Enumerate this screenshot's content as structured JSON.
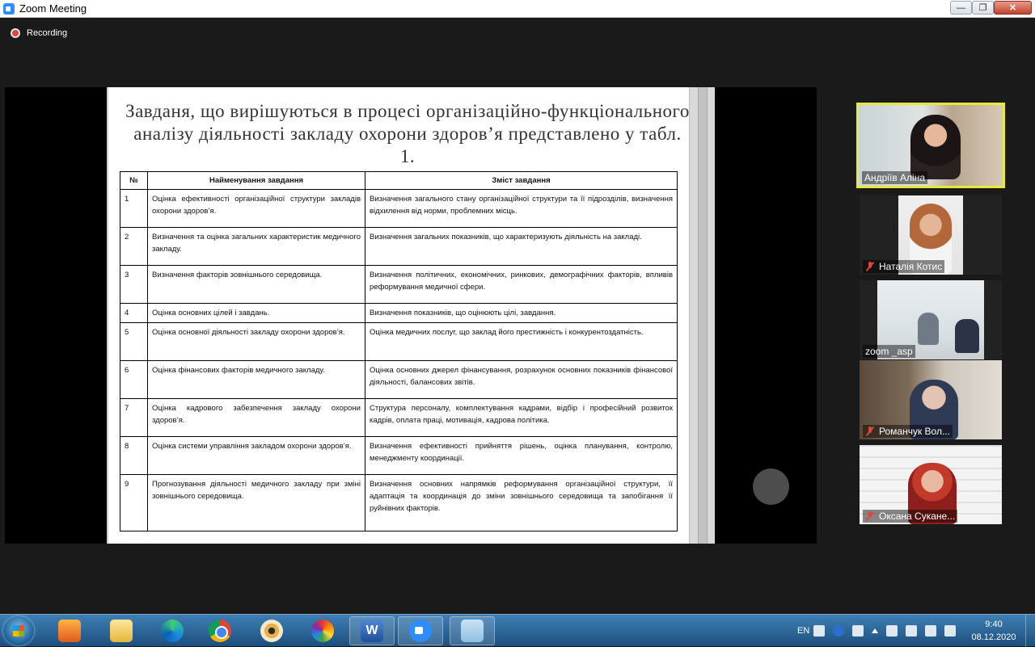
{
  "window": {
    "title": "Zoom Meeting",
    "minimize": "—",
    "maximize": "❐",
    "close": "✕"
  },
  "recording": {
    "label": "Recording"
  },
  "slide": {
    "title": "Завданя, що вирішуються в процесі організаційно-функціонального аналізу діяльності закладу охорони здоров’я представлено у табл. 1.",
    "headers": {
      "num": "№",
      "name": "Найменування завдання",
      "desc": "Зміст завдання"
    },
    "rows": [
      {
        "num": "1",
        "name": "Оцінка ефективності організаційної структури закладів охорони здоров’я.",
        "desc": "Визначення загального стану організаційної структури та її підрозділів, визначення відхилення від норми, проблемних місць."
      },
      {
        "num": "2",
        "name": "Визначення та оцінка загальних характеристик медичного закладу.",
        "desc": "Визначення загальних показників, що характеризують діяльність на закладі."
      },
      {
        "num": "3",
        "name": "Визначення факторів зовнішнього середовища.",
        "desc": "Визначення політичних, економічних, ринкових, демографічних факторів, впливів реформування медичної сфери."
      },
      {
        "num": "4",
        "name": "Оцінка основних цілей і завдань.",
        "desc": "Визначення показників, що оцінюють цілі, завдання."
      },
      {
        "num": "5",
        "name": "Оцінка основної діяльності закладу охорони здоров’я.",
        "desc": "Оцінка медичних послуг, що заклад його престижність і конкурентоздатність."
      },
      {
        "num": "6",
        "name": "Оцінка фінансових факторів медичного закладу.",
        "desc": "Оцінка основних джерел фінансування, розрахунок основних показників фінансової діяльності, балансових звітів."
      },
      {
        "num": "7",
        "name": "Оцінка кадрового забезпечення закладу охорони здоров’я.",
        "desc": "Структура персоналу, комплектування кадрами, відбір і професійний розвиток кадрів, оплата праці, мотивація, кадрова політика."
      },
      {
        "num": "8",
        "name": "Оцінка системи управління закладом охорони здоров’я.",
        "desc": "Визначення ефективності прийняття рішень, оцінка планування, контролю, менеджменту координації."
      },
      {
        "num": "9",
        "name": "Прогнозування діяльності медичного закладу при зміні зовнішнього середовища.",
        "desc": "Визначення основних напрямків реформування організаційної структури, її адаптація та координація до зміни зовнішнього середовища та запобігання її руйнівних факторів."
      }
    ]
  },
  "participants": [
    {
      "name": "Андріїв Аліна",
      "muted": false
    },
    {
      "name": "Наталія Котис",
      "muted": true
    },
    {
      "name": "zoom _asp",
      "muted": false
    },
    {
      "name": "Романчук Вол...",
      "muted": true
    },
    {
      "name": "Оксана Сукане...",
      "muted": true
    }
  ],
  "taskbar": {
    "word_letter": "W",
    "lang": "EN",
    "time": "9:40",
    "date": "08.12.2020"
  }
}
